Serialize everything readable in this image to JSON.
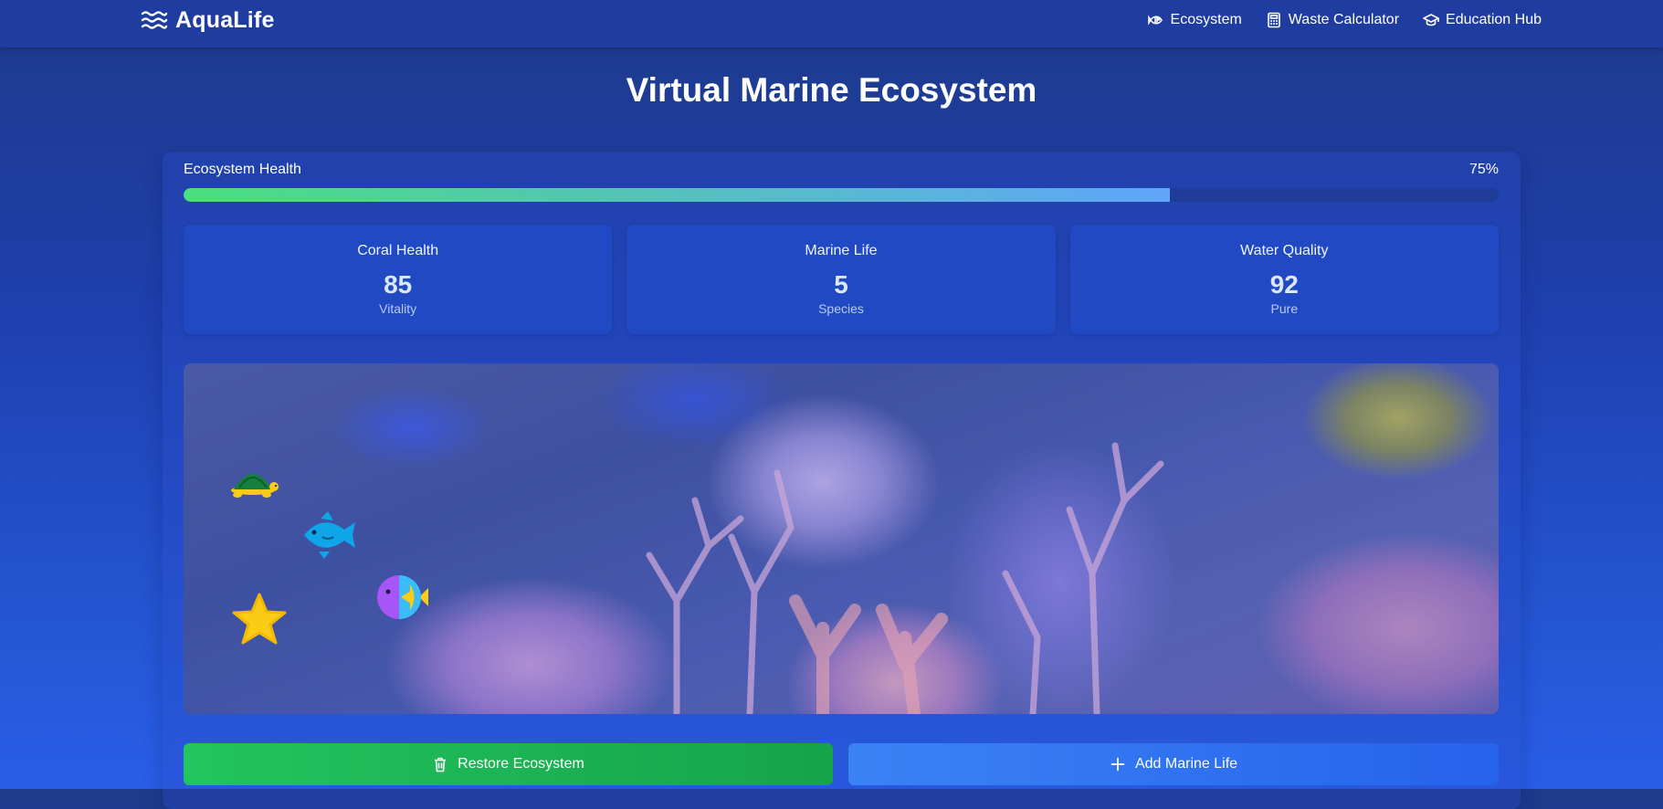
{
  "nav": {
    "logo_text": "AquaLife",
    "links": [
      {
        "label": "Ecosystem",
        "icon": "fish-icon"
      },
      {
        "label": "Waste Calculator",
        "icon": "calculator-icon"
      },
      {
        "label": "Education Hub",
        "icon": "graduation-cap-icon"
      }
    ]
  },
  "page": {
    "title": "Virtual Marine Ecosystem"
  },
  "health": {
    "label": "Ecosystem Health",
    "percent_text": "75%",
    "value": 0.75
  },
  "stats": [
    {
      "label": "Coral Health",
      "value": "85",
      "unit": "Vitality"
    },
    {
      "label": "Marine Life",
      "value": "5",
      "unit": "Species"
    },
    {
      "label": "Water Quality",
      "value": "92",
      "unit": "Pure"
    }
  ],
  "scene": {
    "creatures": [
      "turtle",
      "blue-fish",
      "tropical-fish",
      "starfish"
    ]
  },
  "actions": {
    "restore_label": "Restore Ecosystem",
    "add_label": "Add Marine Life"
  },
  "colors": {
    "health_start": "#4ade80",
    "health_end": "#60a5fa",
    "restore": "#22c55e",
    "add": "#3b82f6"
  }
}
